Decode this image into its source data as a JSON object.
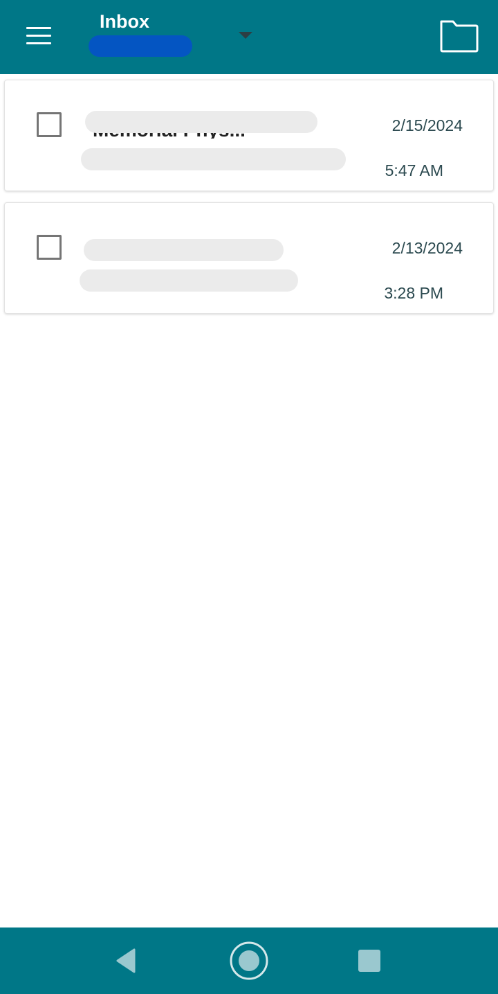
{
  "header": {
    "title": "Inbox",
    "menu_icon": "hamburger-menu-icon",
    "dropdown_icon": "caret-down-icon",
    "folder_icon": "folder-icon",
    "bar_color": "#007787",
    "account_redaction_color": "#0455c2"
  },
  "messages": [
    {
      "sender": "Memorial Phys...",
      "date": "2/15/2024",
      "time": "5:47 AM"
    },
    {
      "sender": "",
      "date": "2/13/2024",
      "time": "3:28 PM"
    }
  ],
  "navigation": {
    "back_icon": "back-triangle-icon",
    "home_icon": "home-circle-icon",
    "recents_icon": "recents-square-icon"
  }
}
